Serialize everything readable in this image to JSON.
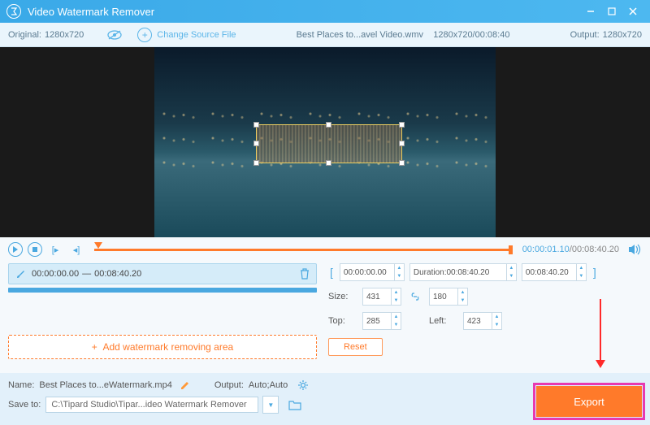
{
  "titlebar": {
    "title": "Video Watermark Remover"
  },
  "infobar": {
    "original_label": "Original:",
    "original_res": "1280x720",
    "change_source": "Change Source File",
    "filename": "Best Places to...avel Video.wmv",
    "file_res_time": "1280x720/00:08:40",
    "output_label": "Output:",
    "output_res": "1280x720"
  },
  "timeline": {
    "current": "00:00:01.10",
    "total": "00:08:40.20"
  },
  "clip": {
    "start": "00:00:00.00",
    "end": "00:08:40.20"
  },
  "add_area_label": "Add watermark removing area",
  "params": {
    "range_start": "00:00:00.00",
    "duration_label": "Duration:",
    "duration_value": "00:08:40.20",
    "range_end": "00:08:40.20",
    "size_label": "Size:",
    "size_w": "431",
    "size_h": "180",
    "top_label": "Top:",
    "top_v": "285",
    "left_label": "Left:",
    "left_v": "423",
    "reset": "Reset"
  },
  "bottom": {
    "name_label": "Name:",
    "name_value": "Best Places to...eWatermark.mp4",
    "output_label": "Output:",
    "output_value": "Auto;Auto",
    "save_label": "Save to:",
    "save_value": "C:\\Tipard Studio\\Tipar...ideo Watermark Remover"
  },
  "export_label": "Export"
}
